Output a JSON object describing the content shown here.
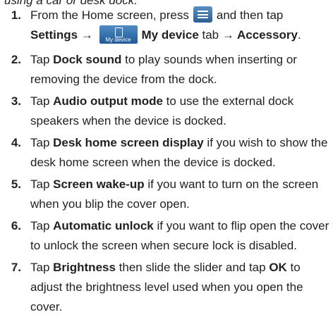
{
  "cut_off_line": "using a car or desk dock.",
  "step1": {
    "number": "1.",
    "a": "From the Home screen, press",
    "b": "and then tap",
    "settings": "Settings",
    "arrow1": " → ",
    "icon_label": "My device",
    "my_device": "My device",
    "tab": " tab ",
    "arrow2": "→ ",
    "accessory": "Accessory",
    "end": "."
  },
  "step2": {
    "number": "2.",
    "pre": "Tap ",
    "bold": "Dock sound",
    "post": " to play sounds when inserting or removing the device from the dock."
  },
  "step3": {
    "number": "3.",
    "pre": "Tap ",
    "bold": "Audio output mode",
    "post": " to use the external dock speakers when the device is docked."
  },
  "step4": {
    "number": "4.",
    "pre": "Tap ",
    "bold": "Desk home screen display",
    "post": " if you wish to show the desk home screen when the device is docked."
  },
  "step5": {
    "number": "5.",
    "pre": "Tap ",
    "bold": "Screen wake-up",
    "post": " if you want to turn on the screen when you blip the cover open."
  },
  "step6": {
    "number": "6.",
    "pre": "Tap ",
    "bold": "Automatic unlock",
    "post": " if you want to flip open the cover to unlock the screen when secure lock is disabled."
  },
  "step7": {
    "number": "7.",
    "pre": "Tap ",
    "bold": "Brightness",
    "mid": " then slide the slider and tap ",
    "bold2": "OK",
    "post": " to adjust the brightness level used when you open the cover."
  },
  "colors": {
    "text": "#231f20",
    "icon_blue": "#2d5f95"
  }
}
